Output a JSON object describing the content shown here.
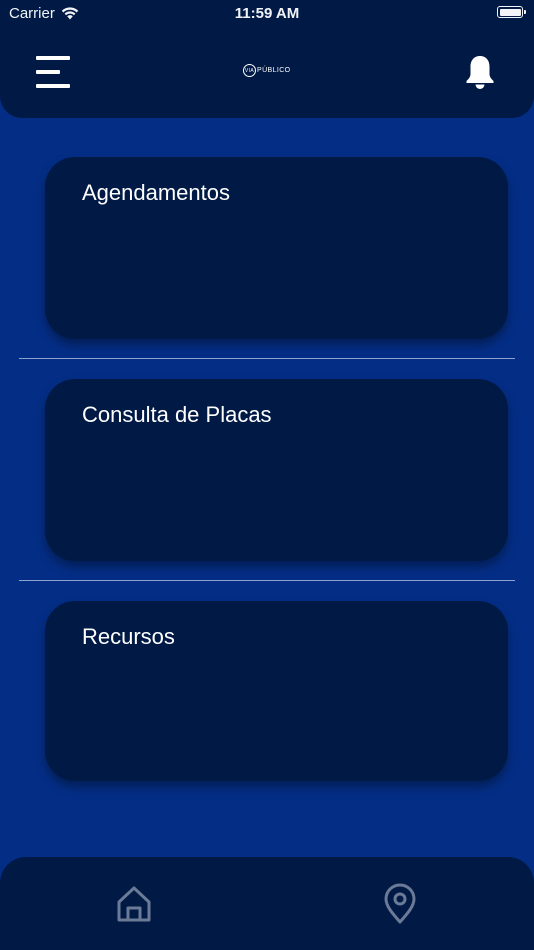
{
  "status_bar": {
    "carrier": "Carrier",
    "time": "11:59 AM"
  },
  "header": {
    "logo_mark": "VIA",
    "logo_text": "PÚBLICO",
    "menu_icon": "hamburger-menu-icon",
    "notification_icon": "bell-icon"
  },
  "cards": [
    {
      "title": "Agendamentos"
    },
    {
      "title": "Consulta de Placas"
    },
    {
      "title": "Recursos"
    }
  ],
  "bottom_nav": {
    "items": [
      {
        "icon": "home-icon"
      },
      {
        "icon": "location-pin-icon"
      }
    ]
  },
  "colors": {
    "background": "#042e86",
    "panel": "#001a45",
    "text": "#ffffff",
    "icon_muted": "#6b7a96",
    "divider": "#8fa3d1"
  }
}
